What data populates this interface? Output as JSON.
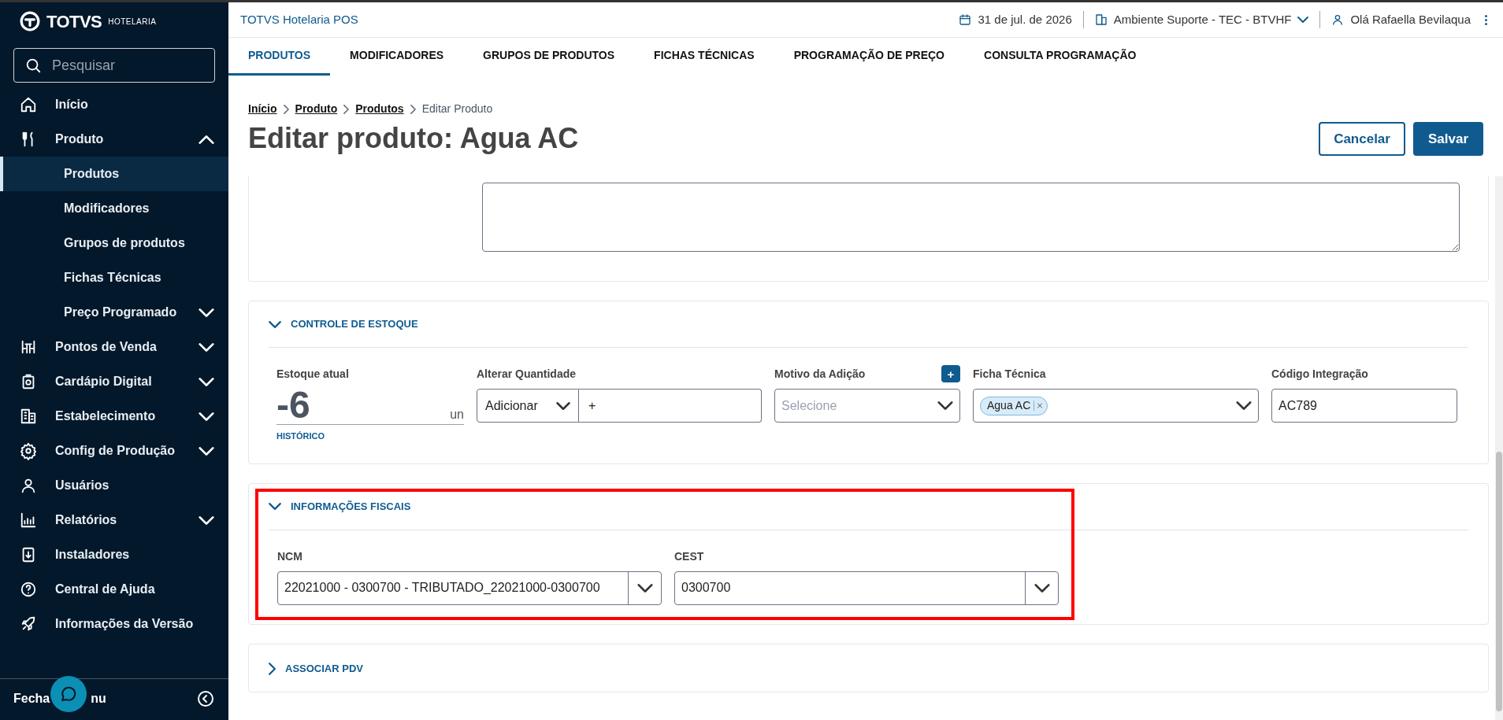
{
  "sidebar": {
    "logo": "TOTVS",
    "logo_sub": "HOTELARIA",
    "search": {
      "placeholder": "Pesquisar"
    },
    "items": [
      {
        "label": "Início",
        "selected": false
      },
      {
        "label": "Produto",
        "selected": false,
        "expanded": true,
        "children": [
          {
            "label": "Produtos",
            "selected": true
          },
          {
            "label": "Modificadores",
            "selected": false
          },
          {
            "label": "Grupos de produtos",
            "selected": false
          },
          {
            "label": "Fichas Técnicas",
            "selected": false
          },
          {
            "label": "Preço Programado",
            "selected": false,
            "expanded": false
          }
        ]
      },
      {
        "label": "Pontos de Venda",
        "selected": false,
        "expanded": false
      },
      {
        "label": "Cardápio Digital",
        "selected": false,
        "expanded": false
      },
      {
        "label": "Estabelecimento",
        "selected": false,
        "expanded": false
      },
      {
        "label": "Config de Produção",
        "selected": false,
        "expanded": false
      },
      {
        "label": "Usuários",
        "selected": false
      },
      {
        "label": "Relatórios",
        "selected": false,
        "expanded": false
      },
      {
        "label": "Instaladores",
        "selected": false
      },
      {
        "label": "Central de Ajuda",
        "selected": false
      },
      {
        "label": "Informações da Versão",
        "selected": false
      }
    ],
    "footer": [
      "Fecha",
      "nu"
    ]
  },
  "header": {
    "app_title": "TOTVS Hotelaria POS",
    "date": "31 de jul. de 2026",
    "environment": "Ambiente Suporte - TEC - BTVHF",
    "user": "Olá Rafaella Bevilaqua"
  },
  "tabs": [
    {
      "label": "PRODUTOS",
      "selected": true
    },
    {
      "label": "MODIFICADORES",
      "selected": false
    },
    {
      "label": "GRUPOS DE PRODUTOS",
      "selected": false
    },
    {
      "label": "FICHAS TÉCNICAS",
      "selected": false
    },
    {
      "label": "PROGRAMAÇÃO DE PREÇO",
      "selected": false
    },
    {
      "label": "CONSULTA PROGRAMAÇÃO",
      "selected": false
    }
  ],
  "breadcrumb": [
    {
      "label": "Início",
      "link": true
    },
    {
      "label": "Produto",
      "link": true
    },
    {
      "label": "Produtos",
      "link": true
    },
    {
      "label": "Editar Produto",
      "link": false
    }
  ],
  "page_title": "Editar produto: Agua AC",
  "buttons": [
    {
      "label": "Cancelar",
      "kind": "secondary"
    },
    {
      "label": "Salvar",
      "kind": "primary"
    }
  ],
  "sections": [
    {
      "kind": "textarea"
    },
    {
      "kind": "stock",
      "title": "CONTROLE DE ESTOQUE",
      "expanded": true,
      "stock": {
        "label": "Estoque atual",
        "value": "-6",
        "unit": "un",
        "link": "HISTÓRICO"
      },
      "change": {
        "label": "Alterar Quantidade",
        "mode": "Adicionar",
        "value": "+"
      },
      "reason": {
        "label": "Motivo da Adição",
        "placeholder": "Selecione",
        "add": "+"
      },
      "recipe": {
        "label": "Ficha Técnica",
        "chips": [
          "Agua AC"
        ]
      },
      "code": {
        "label": "Código Integração",
        "value": "AC789"
      }
    },
    {
      "kind": "fiscal",
      "title": "INFORMAÇÕES FISCAIS",
      "expanded": true,
      "highlighted": true,
      "fields": [
        {
          "label": "NCM",
          "value": "22021000 - 0300700 - TRIBUTADO_22021000-0300700"
        },
        {
          "label": "CEST",
          "value": "0300700"
        }
      ]
    },
    {
      "kind": "collapsed",
      "title": "ASSOCIAR PDV",
      "expanded": false
    }
  ]
}
